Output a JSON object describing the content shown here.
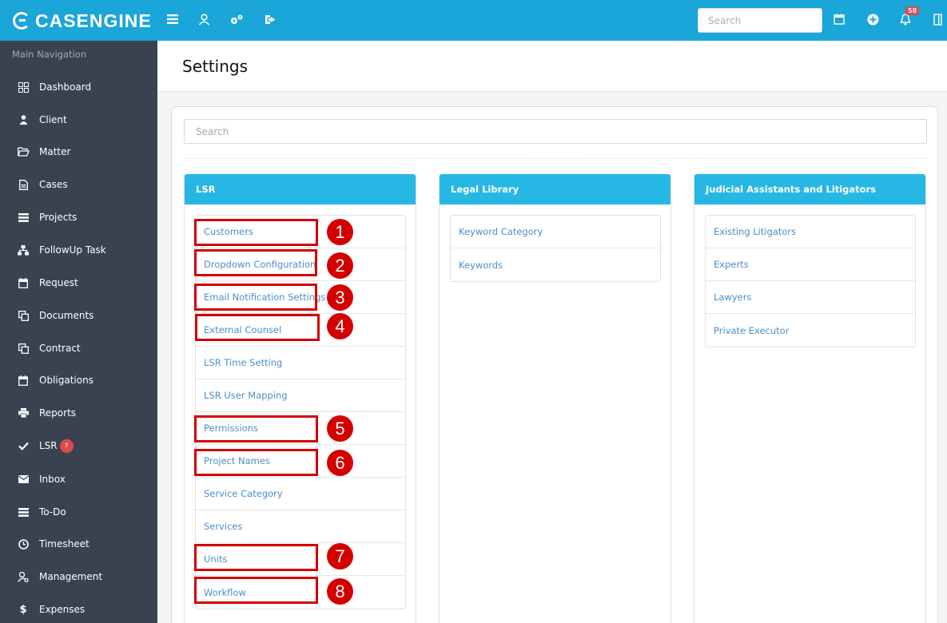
{
  "app": {
    "logo_text": "CASENGINE"
  },
  "header": {
    "search_placeholder": "Search",
    "notification_count": "58"
  },
  "sidebar": {
    "heading": "Main Navigation",
    "items": [
      {
        "label": "Dashboard",
        "icon": "grid-icon"
      },
      {
        "label": "Client",
        "icon": "user-icon"
      },
      {
        "label": "Matter",
        "icon": "folder-open-icon"
      },
      {
        "label": "Cases",
        "icon": "file-icon"
      },
      {
        "label": "Projects",
        "icon": "list-icon"
      },
      {
        "label": "FollowUp Task",
        "icon": "sitemap-icon"
      },
      {
        "label": "Request",
        "icon": "calendar-icon"
      },
      {
        "label": "Documents",
        "icon": "copy-icon"
      },
      {
        "label": "Contract",
        "icon": "copy-icon"
      },
      {
        "label": "Obligations",
        "icon": "calendar-icon"
      },
      {
        "label": "Reports",
        "icon": "print-icon"
      },
      {
        "label": "LSR",
        "icon": "check-icon",
        "badge": "7"
      },
      {
        "label": "Inbox",
        "icon": "envelope-icon"
      },
      {
        "label": "To-Do",
        "icon": "list-icon"
      },
      {
        "label": "Timesheet",
        "icon": "clock-icon"
      },
      {
        "label": "Management",
        "icon": "user-gear-icon"
      },
      {
        "label": "Expenses",
        "icon": "dollar-icon"
      }
    ]
  },
  "main": {
    "title": "Settings",
    "search_placeholder": "Search",
    "panels": [
      {
        "title": "LSR",
        "items": [
          "Customers",
          "Dropdown Configuration",
          "Email Notification Settings",
          "External Counsel",
          "LSR Time Setting",
          "LSR User Mapping",
          "Permissions",
          "Project Names",
          "Service Category",
          "Services",
          "Units",
          "Workflow"
        ]
      },
      {
        "title": "Legal Library",
        "items": [
          "Keyword Category",
          "Keywords"
        ]
      },
      {
        "title": "Judicial Assistants and Litigators",
        "items": [
          "Existing Litigators",
          "Experts",
          "Lawyers",
          "Private Executor"
        ]
      }
    ]
  },
  "annotations": [
    "1",
    "2",
    "3",
    "4",
    "5",
    "6",
    "7",
    "8"
  ],
  "colors": {
    "header": "#1aa6d8",
    "sidebar": "#3a4250",
    "panel_head": "#27b7e5",
    "link": "#4a8fc9",
    "annotation": "#d40000"
  }
}
